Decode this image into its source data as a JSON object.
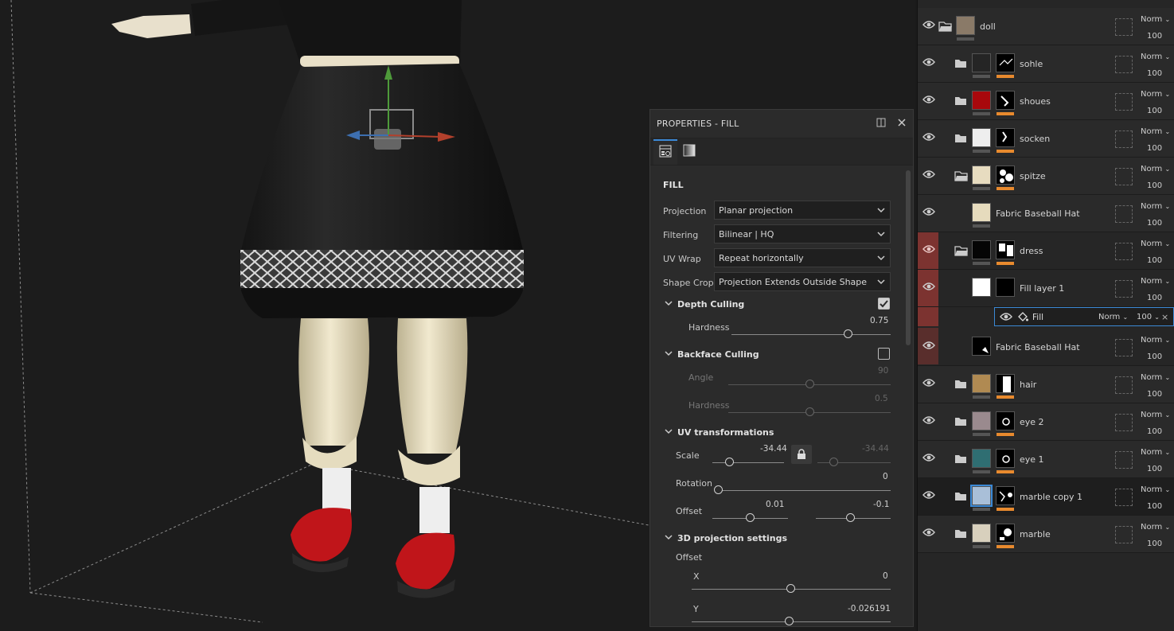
{
  "properties": {
    "title": "PROPERTIES - FILL",
    "section": "FILL",
    "projection": {
      "label": "Projection",
      "value": "Planar projection"
    },
    "filtering": {
      "label": "Filtering",
      "value": "Bilinear | HQ"
    },
    "uv_wrap": {
      "label": "UV Wrap",
      "value": "Repeat horizontally"
    },
    "shape_crop": {
      "label": "Shape Crop",
      "value": "Projection Extends Outside Shape"
    },
    "depth_culling": {
      "title": "Depth Culling",
      "checked": true,
      "hardness_label": "Hardness",
      "hardness_value": "0.75",
      "hardness": 0.75
    },
    "backface_culling": {
      "title": "Backface Culling",
      "checked": false,
      "angle_label": "Angle",
      "angle_value": "90",
      "hardness_label": "Hardness",
      "hardness_value": "0.5"
    },
    "uv_transformations": {
      "title": "UV transformations",
      "scale_label": "Scale",
      "scale_u": "-34.44",
      "scale_v": "-34.44",
      "rotation_label": "Rotation",
      "rotation_value": "0",
      "offset_label": "Offset",
      "offset_u": "0.01",
      "offset_v": "-0.1"
    },
    "projection_3d": {
      "title": "3D projection settings",
      "offset_label": "Offset",
      "x_label": "X",
      "x_value": "0",
      "y_label": "Y",
      "y_value": "-0.026191"
    }
  },
  "layers": [
    {
      "name": "doll",
      "blend": "Norm",
      "opacity": "100"
    },
    {
      "name": "sohle",
      "blend": "Norm",
      "opacity": "100"
    },
    {
      "name": "shoues",
      "blend": "Norm",
      "opacity": "100"
    },
    {
      "name": "socken",
      "blend": "Norm",
      "opacity": "100"
    },
    {
      "name": "spitze",
      "blend": "Norm",
      "opacity": "100"
    },
    {
      "name": "Fabric Baseball Hat",
      "blend": "Norm",
      "opacity": "100"
    },
    {
      "name": "dress",
      "blend": "Norm",
      "opacity": "100"
    },
    {
      "name": "Fill layer 1",
      "blend": "Norm",
      "opacity": "100"
    },
    {
      "name": "Fabric Baseball Hat",
      "blend": "Norm",
      "opacity": "100"
    },
    {
      "name": "hair",
      "blend": "Norm",
      "opacity": "100"
    },
    {
      "name": "eye 2",
      "blend": "Norm",
      "opacity": "100"
    },
    {
      "name": "eye 1",
      "blend": "Norm",
      "opacity": "100"
    },
    {
      "name": "marble copy 1",
      "blend": "Norm",
      "opacity": "100"
    },
    {
      "name": "marble",
      "blend": "Norm",
      "opacity": "100"
    }
  ],
  "fill_effect": {
    "name": "Fill",
    "blend": "Norm",
    "opacity": "100",
    "close": "×"
  },
  "colors": {
    "accent": "#3b89d6",
    "mask_bar": "#e88a2e",
    "selected_group": "#7c3330"
  }
}
